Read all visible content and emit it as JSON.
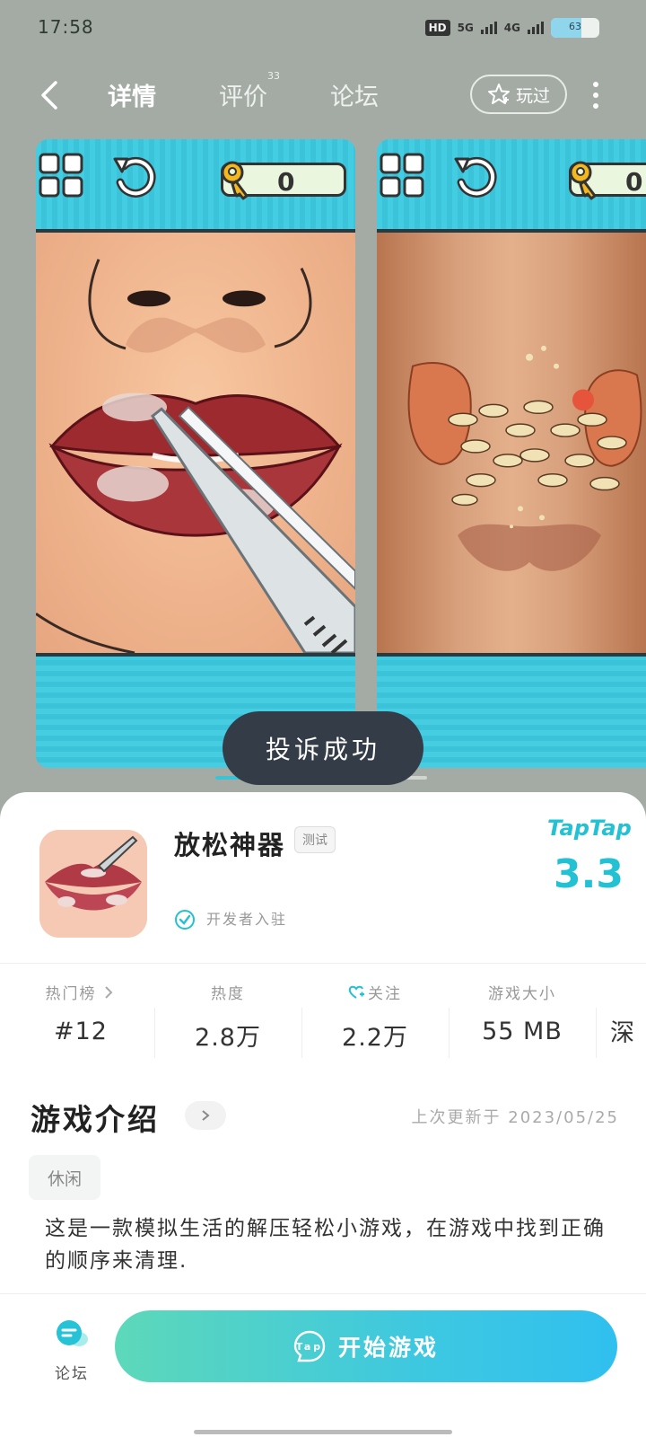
{
  "status_bar": {
    "time": "17:58",
    "network_badge": "HD",
    "network_1": "5G",
    "network_2": "4G",
    "battery_text": "63",
    "battery_level": 0.63
  },
  "nav": {
    "tabs": [
      {
        "label": "详情",
        "active": true
      },
      {
        "label": "评价",
        "active": false
      },
      {
        "label": "论坛",
        "active": false
      }
    ],
    "review_count": "33",
    "played_label": "玩过"
  },
  "screenshots": [
    {
      "key_count": "0"
    },
    {
      "key_count": "0"
    }
  ],
  "toast": "投诉成功",
  "app": {
    "name": "放松神器",
    "badge": "测试",
    "developer_label": "开发者入驻",
    "platform_logo": "TapTap",
    "rating": "3.3"
  },
  "stats": [
    {
      "label": "热门榜",
      "value": "#12"
    },
    {
      "label": "热度",
      "value": "2.8万"
    },
    {
      "label": "关注",
      "value": "2.2万"
    },
    {
      "label": "游戏大小",
      "value": "55 MB"
    },
    {
      "label": "",
      "value": "深"
    }
  ],
  "intro": {
    "title": "游戏介绍",
    "update_text": "上次更新于 2023/05/25",
    "tag": "休闲",
    "description": "这是一款模拟生活的解压轻松小游戏，在游戏中找到正确的顺序来清理."
  },
  "bottom": {
    "forum_label": "论坛",
    "start_label": "开始游戏",
    "tap_logo_text": "Tap"
  },
  "colors": {
    "accent": "#22c1d3",
    "sheet_bg": "#ffffff",
    "page_bg": "#a3aba4",
    "toast_bg": "#343c48"
  }
}
